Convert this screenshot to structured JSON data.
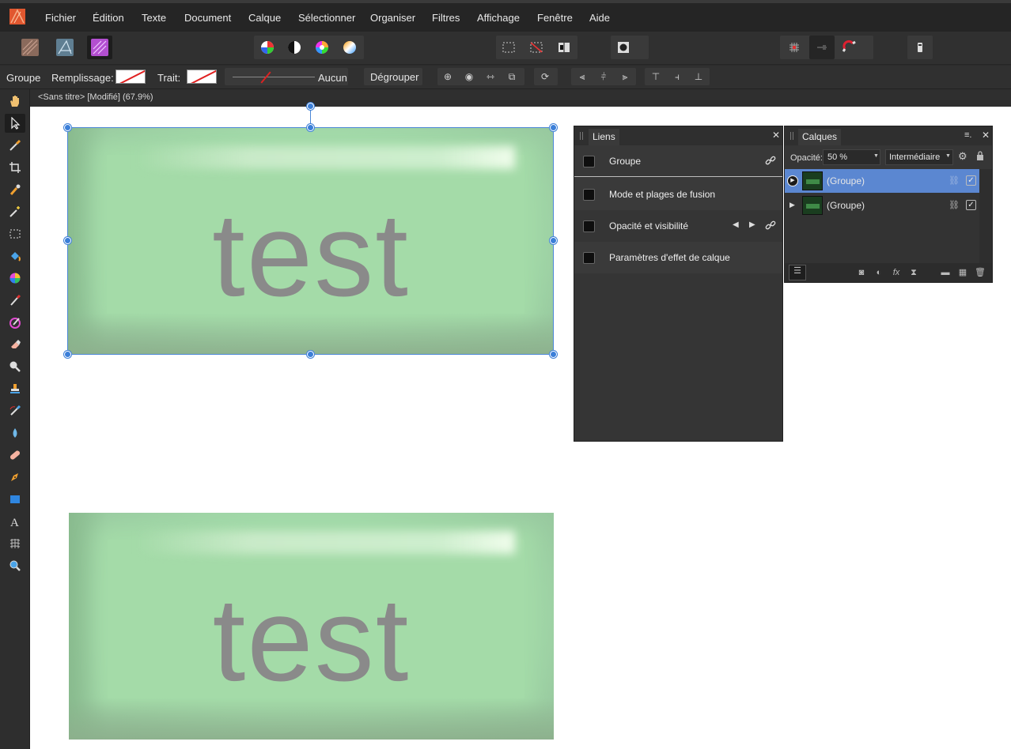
{
  "menu": {
    "items": [
      "Fichier",
      "Édition",
      "Texte",
      "Document",
      "Calque",
      "Sélectionner",
      "Organiser",
      "Filtres",
      "Affichage",
      "Fenêtre",
      "Aide"
    ]
  },
  "context": {
    "mode": "Groupe",
    "fill_label": "Remplissage:",
    "stroke_label": "Trait:",
    "stroke_style": "Aucun",
    "ungroup_button": "Dégrouper"
  },
  "document": {
    "tab_title": "<Sans titre> [Modifié] (67.9%)"
  },
  "canvas": {
    "top_box_text": "test",
    "bottom_box_text": "test"
  },
  "liens": {
    "tab": "Liens",
    "rows": [
      "Groupe",
      "Mode et plages de fusion",
      "Opacité et visibilité",
      "Paramètres d'effet de calque"
    ]
  },
  "calques": {
    "tab": "Calques",
    "opacity_label": "Opacité:",
    "opacity_value": "50 %",
    "blend_mode": "Intermédiaire",
    "layers": [
      "(Groupe)",
      "(Groupe)"
    ]
  },
  "colors": {
    "selection": "#4b86d6",
    "selected_layer": "#5b87d1",
    "box_green": "#a4dba8"
  }
}
